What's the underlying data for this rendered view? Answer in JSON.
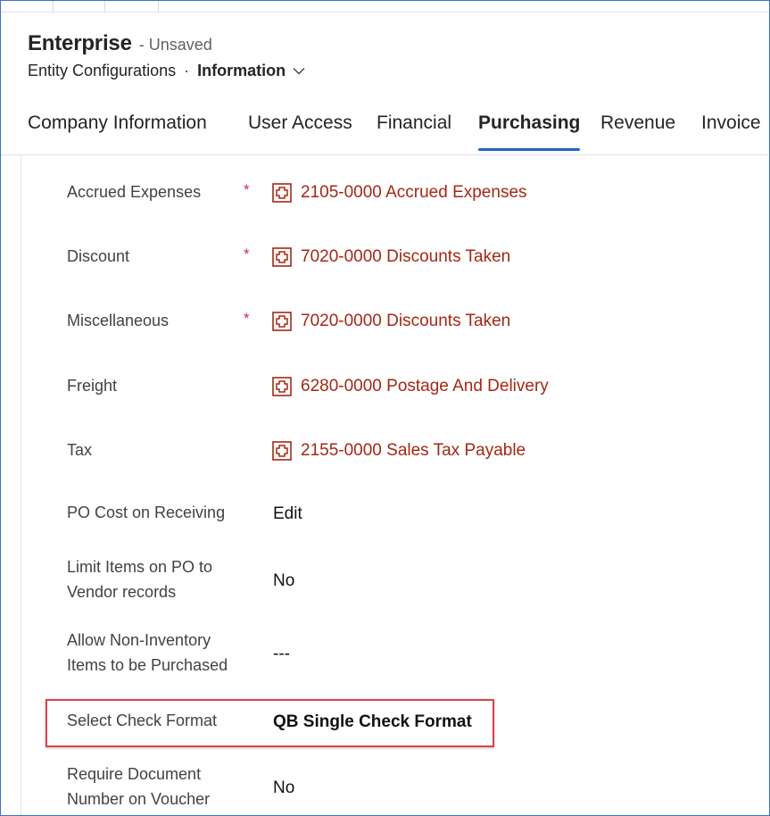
{
  "header": {
    "title": "Enterprise",
    "status": "- Unsaved",
    "entity": "Entity Configurations",
    "separator": "·",
    "form_selector": "Information"
  },
  "tabs": [
    {
      "label": "Company Information",
      "active": false
    },
    {
      "label": "User Access",
      "active": false
    },
    {
      "label": "Financial",
      "active": false
    },
    {
      "label": "Purchasing",
      "active": true
    },
    {
      "label": "Revenue",
      "active": false
    },
    {
      "label": "Invoice",
      "active": false
    }
  ],
  "fields": {
    "accrued_expenses": {
      "label": "Accrued Expenses",
      "required": "*",
      "value": "2105-0000 Accrued Expenses",
      "icon": "lookup-entity-icon"
    },
    "discount": {
      "label": "Discount",
      "required": "*",
      "value": "7020-0000 Discounts Taken",
      "icon": "lookup-entity-icon"
    },
    "miscellaneous": {
      "label": "Miscellaneous",
      "required": "*",
      "value": "7020-0000 Discounts Taken",
      "icon": "lookup-entity-icon"
    },
    "freight": {
      "label": "Freight",
      "value": "6280-0000 Postage And Delivery",
      "icon": "lookup-entity-icon"
    },
    "tax": {
      "label": "Tax",
      "value": "2155-0000 Sales Tax Payable",
      "icon": "lookup-entity-icon"
    },
    "po_cost_on_receiving": {
      "label": "PO Cost on Receiving",
      "value": "Edit"
    },
    "limit_items_line1": "Limit Items on PO to",
    "limit_items_line2": "Vendor records",
    "limit_items_value": "No",
    "allow_noninv_line1": "Allow Non-Inventory",
    "allow_noninv_line2": "Items to be Purchased",
    "allow_noninv_value": "---",
    "select_check_format": {
      "label": "Select Check Format",
      "value": "QB Single Check Format"
    },
    "require_doc_line1": "Require Document",
    "require_doc_line2": "Number on Voucher",
    "require_doc_value": "No"
  },
  "colors": {
    "accent": "#2266c5",
    "lookup_text": "#a52714",
    "required": "#c4314b",
    "highlight_border": "#d9434a"
  }
}
